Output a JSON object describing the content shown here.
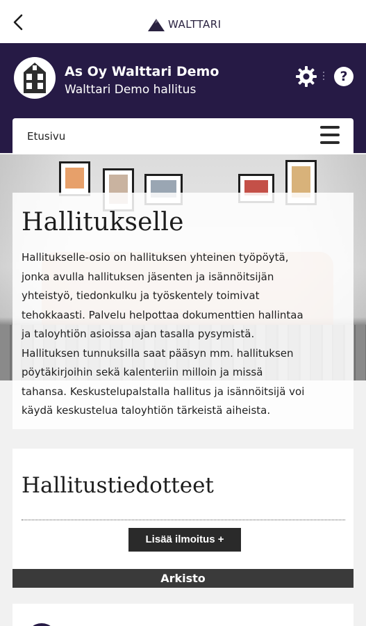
{
  "topbar": {
    "back_icon": "chevron-left-icon",
    "logo_text": "WALTTARI"
  },
  "header": {
    "org_name": "As Oy Walttari Demo",
    "org_subtitle": "Walttari Demo hallitus",
    "settings_icon": "gear-icon",
    "help_label": "?"
  },
  "nav": {
    "current_page": "Etusivu",
    "menu_icon": "hamburger-menu-icon"
  },
  "intro": {
    "title": "Hallitukselle",
    "lines": [
      "Hallitukselle-osio on hallituksen yhteinen työpöytä,",
      "jonka avulla hallituksen jäsenten ja isännöitsijän",
      "yhteistyö, tiedonkulku ja työskentely toimivat",
      "tehokkaasti. Palvelu helpottaa dokumenttien hallintaa",
      "ja taloyhtiön asioissa ajan tasalla pysymistä.",
      "Hallituksen tunnuksilla saat pääsyn mm. hallituksen",
      "pöytäkirjoihin sekä kalenteriin milloin ja missä",
      "tahansa. Keskustelupalstalla hallitus ja isännöitsijä voi",
      "käydä keskustelua taloyhtiön tärkeistä aiheista."
    ]
  },
  "announcements": {
    "title": "Hallitustiedotteet",
    "add_button": "Lisää ilmoitus +",
    "archive_label": "Arkisto"
  },
  "colors": {
    "header_bg": "#261a45",
    "button_bg": "#2a2a2a",
    "archive_bg": "#3a3a3a"
  }
}
